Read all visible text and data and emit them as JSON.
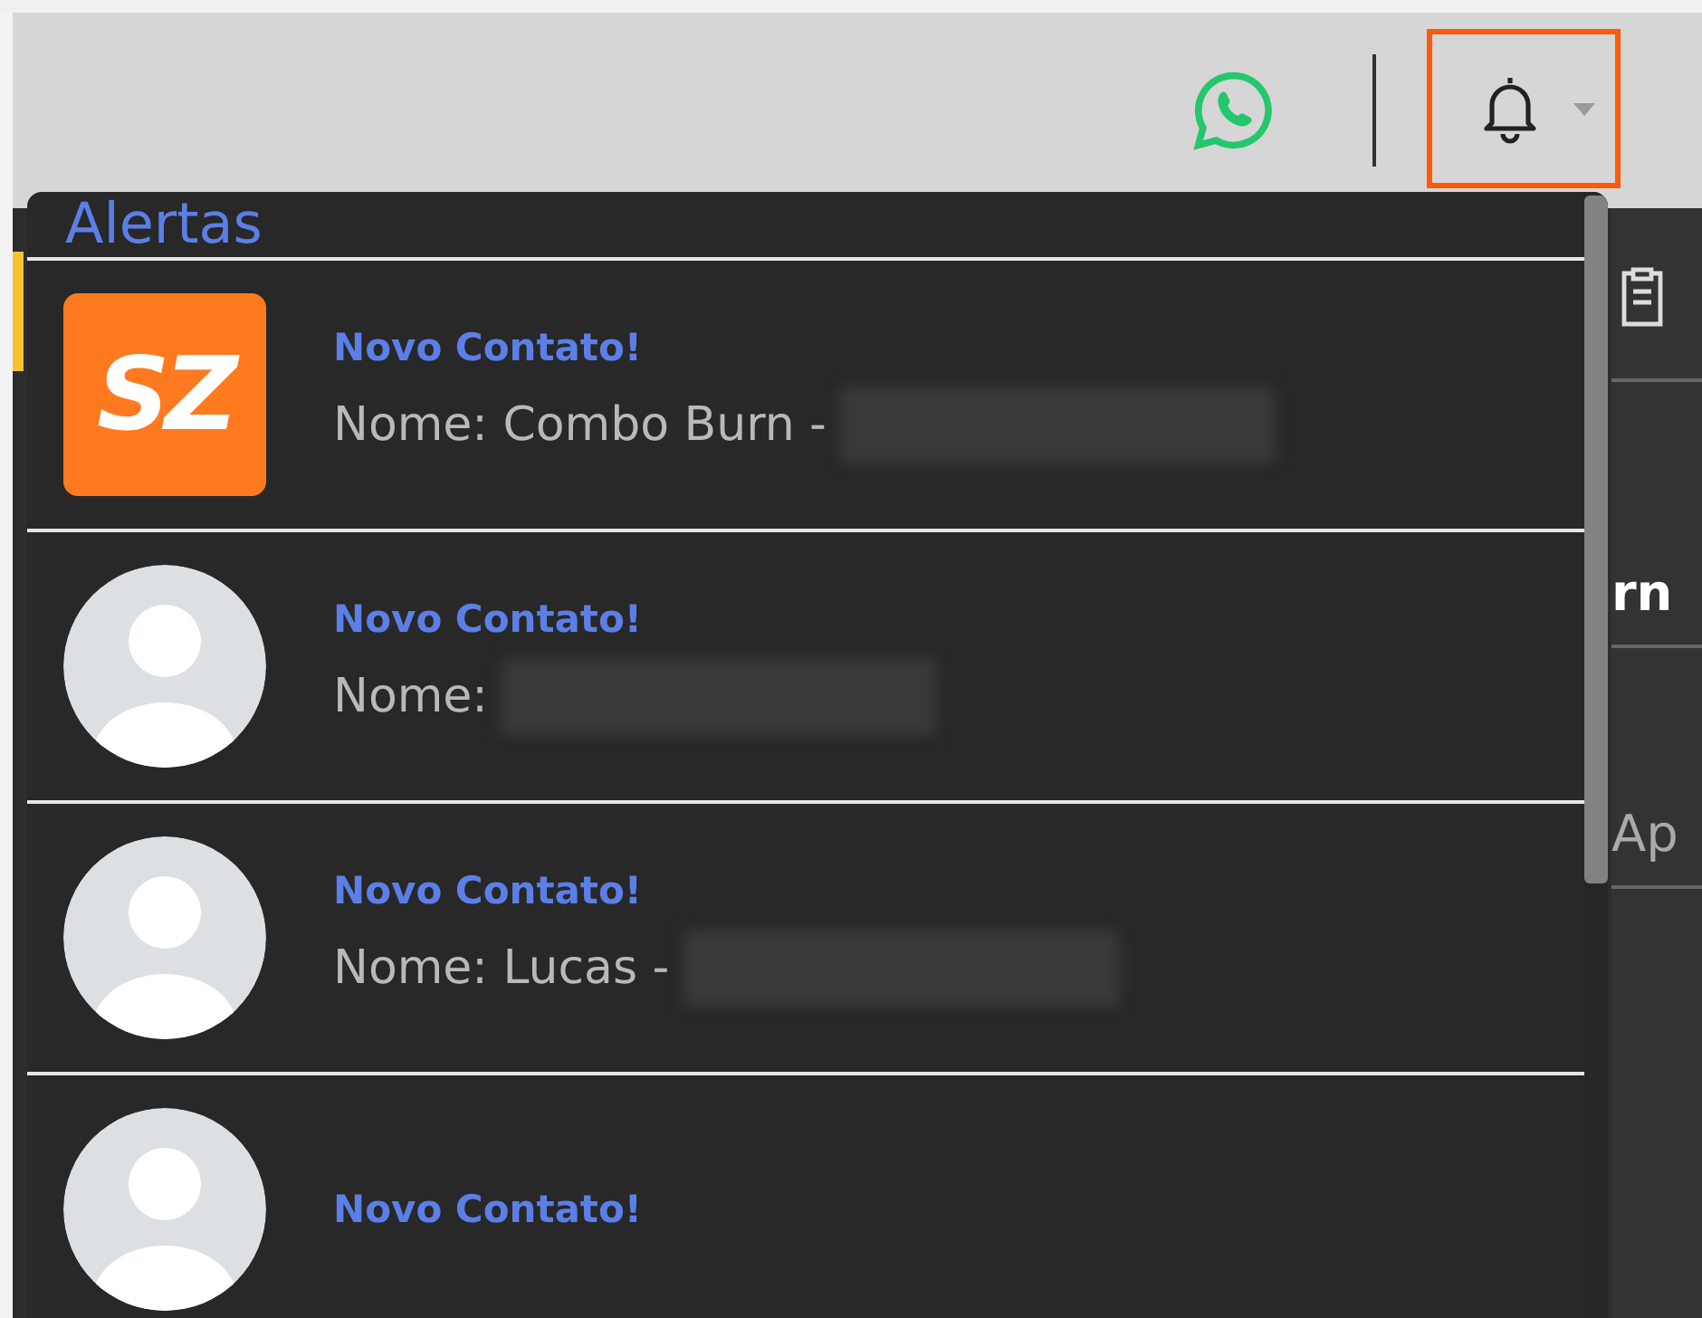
{
  "topbar": {
    "notifications_open": true
  },
  "background": {
    "fragments": [
      "rn",
      "Ap"
    ]
  },
  "alerts": {
    "title": "Alertas",
    "items": [
      {
        "kind": "logo",
        "logo_text": "SZ",
        "title": "Novo Contato!",
        "name": "Nome: Combo Burn -",
        "redacted": true
      },
      {
        "kind": "default",
        "title": "Novo Contato!",
        "name": "Nome:",
        "redacted": true
      },
      {
        "kind": "default",
        "title": "Novo Contato!",
        "name": "Nome: Lucas -",
        "redacted": true
      },
      {
        "kind": "default",
        "title": "Novo Contato!"
      }
    ]
  }
}
